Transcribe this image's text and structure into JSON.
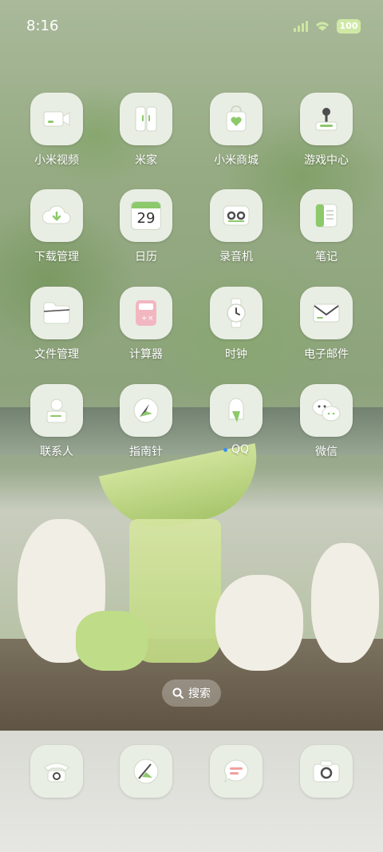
{
  "status_bar": {
    "time": "8:16",
    "battery": "100",
    "signal_icon": "signal-bars-icon",
    "wifi_icon": "wifi-icon",
    "accent": "#cfe9a5"
  },
  "apps": [
    {
      "label": "小米视频",
      "icon": "video-camera-icon"
    },
    {
      "label": "米家",
      "icon": "door-icon"
    },
    {
      "label": "小米商城",
      "icon": "shopping-bag-icon"
    },
    {
      "label": "游戏中心",
      "icon": "joystick-icon"
    },
    {
      "label": "下载管理",
      "icon": "cloud-download-icon"
    },
    {
      "label": "日历",
      "icon": "calendar-icon",
      "date": "29"
    },
    {
      "label": "录音机",
      "icon": "recorder-icon"
    },
    {
      "label": "笔记",
      "icon": "notebook-icon"
    },
    {
      "label": "文件管理",
      "icon": "folder-icon"
    },
    {
      "label": "计算器",
      "icon": "calculator-icon"
    },
    {
      "label": "时钟",
      "icon": "watch-icon"
    },
    {
      "label": "电子邮件",
      "icon": "envelope-icon"
    },
    {
      "label": "联系人",
      "icon": "contact-card-icon"
    },
    {
      "label": "指南针",
      "icon": "compass-icon"
    },
    {
      "label": "QQ",
      "icon": "qq-penguin-icon"
    },
    {
      "label": "微信",
      "icon": "wechat-icon"
    }
  ],
  "search": {
    "label": "搜索",
    "icon": "search-icon"
  },
  "dock": [
    {
      "icon": "phone-icon"
    },
    {
      "icon": "browser-compass-icon"
    },
    {
      "icon": "message-icon"
    },
    {
      "icon": "camera-icon"
    }
  ],
  "colors": {
    "icon_bg": "#e9eee4",
    "icon_glyph": "#8cc96b",
    "icon_dark": "#4d4d4d",
    "calculator_pink": "#f2b6c1"
  }
}
